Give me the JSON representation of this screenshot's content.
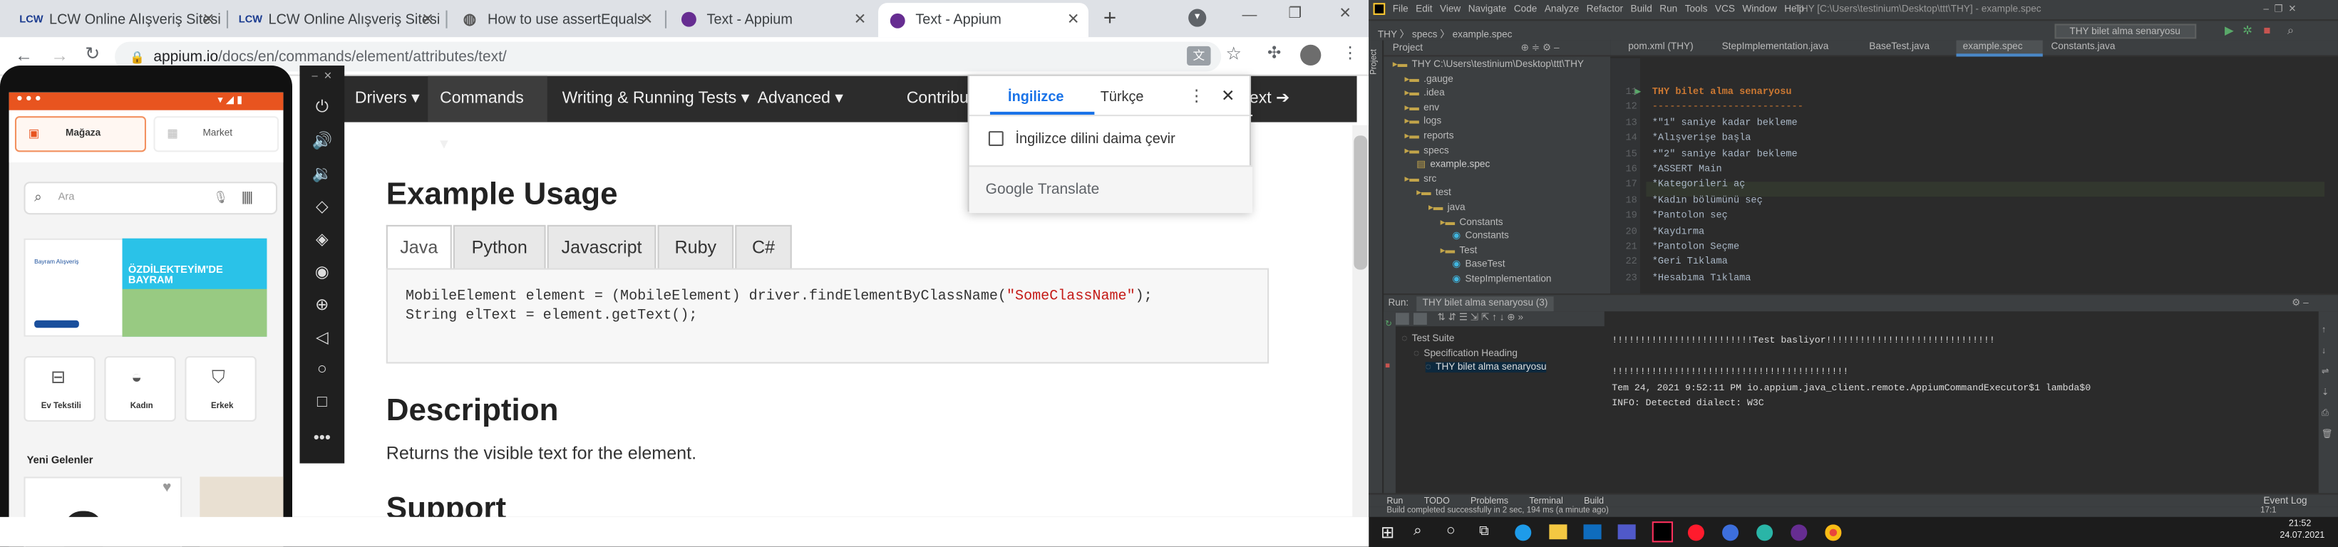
{
  "browser": {
    "tabs": [
      {
        "fav": "LCW",
        "title": "LCW Online Alışveriş Sitesi"
      },
      {
        "fav": "LCW",
        "title": "LCW Online Alışveriş Sitesi"
      },
      {
        "fav": "globe-icon",
        "title": "How to use assertEquals"
      },
      {
        "fav": "appium-icon",
        "title": "Text - Appium"
      },
      {
        "fav": "appium-icon",
        "title": "Text - Appium"
      }
    ],
    "url_host": "appium.io",
    "url_path": "/docs/en/commands/element/attributes/text/"
  },
  "site_nav": {
    "items": [
      "Drivers ▾",
      "Commands ▾",
      "Writing & Running Tests ▾",
      "Advanced ▾",
      "Contributing ▾"
    ],
    "next": "ext ➔"
  },
  "doc": {
    "example_heading": "Example Usage",
    "code_tabs": [
      "Java",
      "Python",
      "Javascript",
      "Ruby",
      "C#"
    ],
    "code_line1_a": "MobileElement element = (MobileElement) driver.findElementByClassName(",
    "code_line1_str": "\"SomeClassName\"",
    "code_line1_b": ");",
    "code_line2": "String elText = element.getText();",
    "description_heading": "Description",
    "description_text": "Returns the visible text for the element.",
    "support_heading": "Support"
  },
  "translate": {
    "tab_from": "İngilizce",
    "tab_to": "Türkçe",
    "option": "İngilizce dilini daima çevir",
    "brand_google": "Google",
    "brand_translate": "Translate"
  },
  "phone": {
    "tab_store": "Mağaza",
    "tab_market": "Market",
    "search_placeholder": "Ara",
    "banner_small": "Bayram Alışveriş",
    "banner_big": "ÖZDİLEKTEYİM'DE BAYRAM",
    "cats": [
      "Ev Tekstili",
      "Kadın",
      "Erkek"
    ],
    "new_arrivals": "Yeni Gelenler"
  },
  "ide": {
    "menu": [
      "File",
      "Edit",
      "View",
      "Navigate",
      "Code",
      "Analyze",
      "Refactor",
      "Build",
      "Run",
      "Tools",
      "VCS",
      "Window",
      "Help"
    ],
    "title": "THY [C:\\Users\\testinium\\Desktop\\ttt\\THY] - example.spec",
    "breadcrumb": "THY 〉 specs 〉 example.spec",
    "run_config": "THY bilet alma senaryosu (3)",
    "editor_tabs": [
      "pom.xml (THY)",
      "StepImplementation.java",
      "BaseTest.java",
      "example.spec",
      "Constants.java"
    ],
    "project_label": "Project",
    "tree": [
      {
        "d": 0,
        "t": "THY  C:\\Users\\testinium\\Desktop\\ttt\\THY"
      },
      {
        "d": 1,
        "t": ".gauge"
      },
      {
        "d": 1,
        "t": ".idea"
      },
      {
        "d": 1,
        "t": "env"
      },
      {
        "d": 1,
        "t": "logs"
      },
      {
        "d": 1,
        "t": "reports"
      },
      {
        "d": 1,
        "t": "specs"
      },
      {
        "d": 2,
        "t": "example.spec"
      },
      {
        "d": 1,
        "t": "src"
      },
      {
        "d": 2,
        "t": "test"
      },
      {
        "d": 3,
        "t": "java"
      },
      {
        "d": 4,
        "t": "Constants"
      },
      {
        "d": 5,
        "t": "Constants"
      },
      {
        "d": 4,
        "t": "Test"
      },
      {
        "d": 5,
        "t": "BaseTest"
      },
      {
        "d": 5,
        "t": "StepImplementation"
      }
    ],
    "code": [
      {
        "n": "11",
        "t": "THY bilet alma senaryosu"
      },
      {
        "n": "12",
        "t": "--------------------------"
      },
      {
        "n": "13",
        "t": "*\"1\" saniye kadar bekleme"
      },
      {
        "n": "14",
        "t": "*Alışverişe başla"
      },
      {
        "n": "15",
        "t": "*\"2\" saniye kadar bekleme"
      },
      {
        "n": "16",
        "t": "*ASSERT Main"
      },
      {
        "n": "17",
        "t": "*Kategorileri aç"
      },
      {
        "n": "18",
        "t": "*Kadın bölümünü seç"
      },
      {
        "n": "19",
        "t": "*Pantolon seç"
      },
      {
        "n": "20",
        "t": "*Kaydırma"
      },
      {
        "n": "21",
        "t": "*Pantolon Seçme"
      },
      {
        "n": "22",
        "t": "*Geri Tıklama"
      },
      {
        "n": "23",
        "t": "*Hesabıma Tıklama"
      }
    ],
    "run_label": "Run:",
    "run_tab": "THY bilet alma senaryosu (3)",
    "run_tree": [
      "Test Suite",
      "Specification Heading",
      "THY bilet alma senaryosu"
    ],
    "console": [
      "!!!!!!!!!!!!!!!!!!!!!!!!!Test basliyor!!!!!!!!!!!!!!!!!!!!!!!!!!!!!!",
      "",
      "!!!!!!!!!!!!!!!!!!!!!!!!!!!!!!!!!!!!!!!!!!",
      "Tem 24, 2021 9:52:11 PM io.appium.java_client.remote.AppiumCommandExecutor$1 lambda$0",
      "INFO: Detected dialect: W3C"
    ],
    "bottom_tabs": [
      "Run",
      "TODO",
      "Problems",
      "Terminal",
      "Build"
    ],
    "event_log": "Event Log",
    "status": "Build completed successfully in 2 sec, 194 ms (a minute ago)",
    "position": "17:1"
  },
  "clock": {
    "time": "21:52",
    "date": "24.07.2021"
  },
  "colors": {
    "ide_bg": "#2b2b2b",
    "ide_panel": "#3c3f41",
    "keyword": "#cc7832",
    "chrome_tab": "#dee1e6",
    "site_nav": "#2c2c2c",
    "appium_purple": "#662d91"
  }
}
